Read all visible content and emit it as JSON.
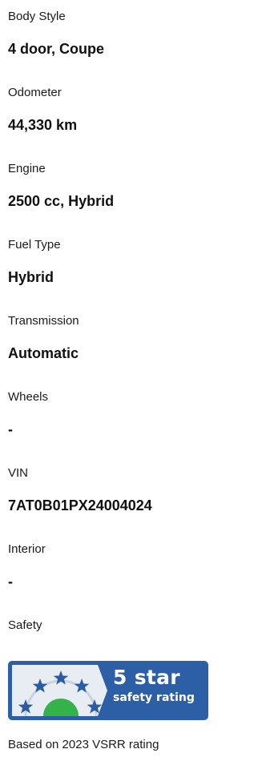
{
  "specs": [
    {
      "label": "Body Style",
      "value": "4 door, Coupe"
    },
    {
      "label": "Odometer",
      "value": "44,330 km"
    },
    {
      "label": "Engine",
      "value": "2500 cc, Hybrid"
    },
    {
      "label": "Fuel Type",
      "value": "Hybrid"
    },
    {
      "label": "Transmission",
      "value": "Automatic"
    },
    {
      "label": "Wheels",
      "value": "-"
    },
    {
      "label": "VIN",
      "value": "7AT0B01PX24004024"
    },
    {
      "label": "Interior",
      "value": "-"
    },
    {
      "label": "Safety",
      "value": ""
    }
  ],
  "safety": {
    "badge_line1": "5 star",
    "badge_line2": "safety rating",
    "stars": 5,
    "footnote": "Based on 2023 VSRR rating",
    "colors": {
      "badge_blue": "#2d5fa6",
      "star_blue": "#2b5ca3",
      "ring_grey": "#d8dee6",
      "green": "#33b34a"
    }
  }
}
